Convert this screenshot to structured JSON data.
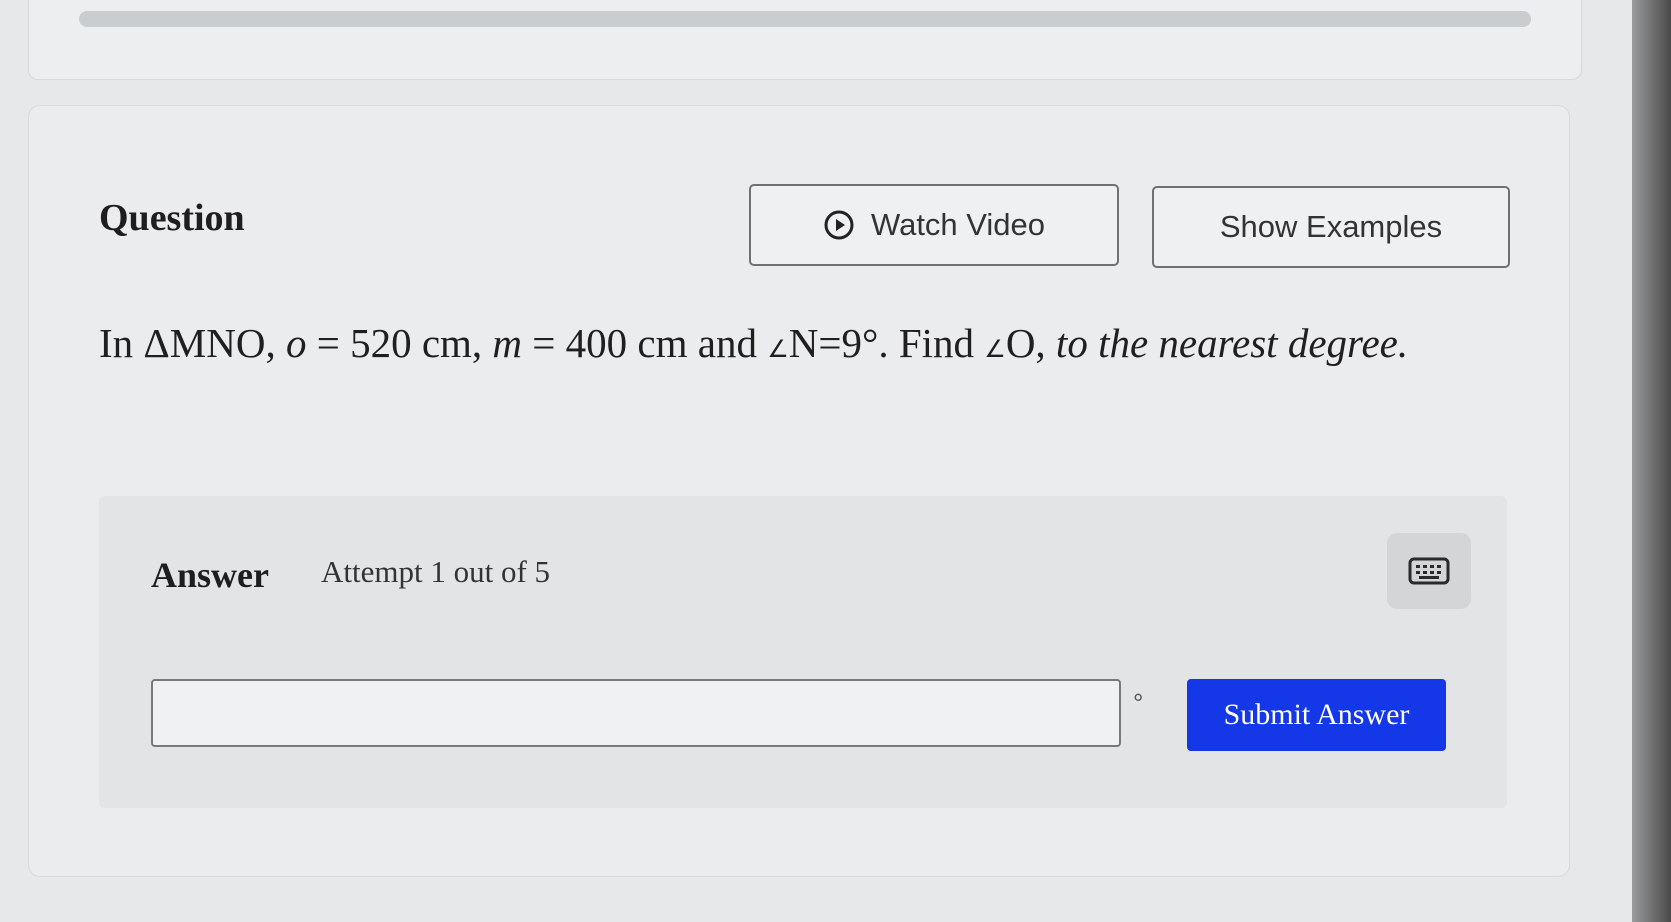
{
  "question": {
    "title": "Question",
    "watch_video_label": "Watch Video",
    "show_examples_label": "Show Examples",
    "problem": {
      "intro": "In ",
      "triangle": "ΔMNO",
      "sep1": ", ",
      "var_o": "o",
      "eq1": " = 520 cm, ",
      "var_m": "m",
      "eq2": " = 400 cm and ",
      "angle_symbol": "∠",
      "angle_n": "N=9°. Find ",
      "angle_o": "O, ",
      "instruction": "to the nearest degree."
    }
  },
  "answer": {
    "label": "Answer",
    "attempt_text": "Attempt 1 out of 5",
    "input_value": "",
    "input_placeholder": "",
    "unit": "°",
    "submit_label": "Submit Answer",
    "keyboard_icon": "keyboard-icon"
  },
  "colors": {
    "submit_blue": "#1438e8",
    "panel_bg": "#e2e4e5"
  }
}
